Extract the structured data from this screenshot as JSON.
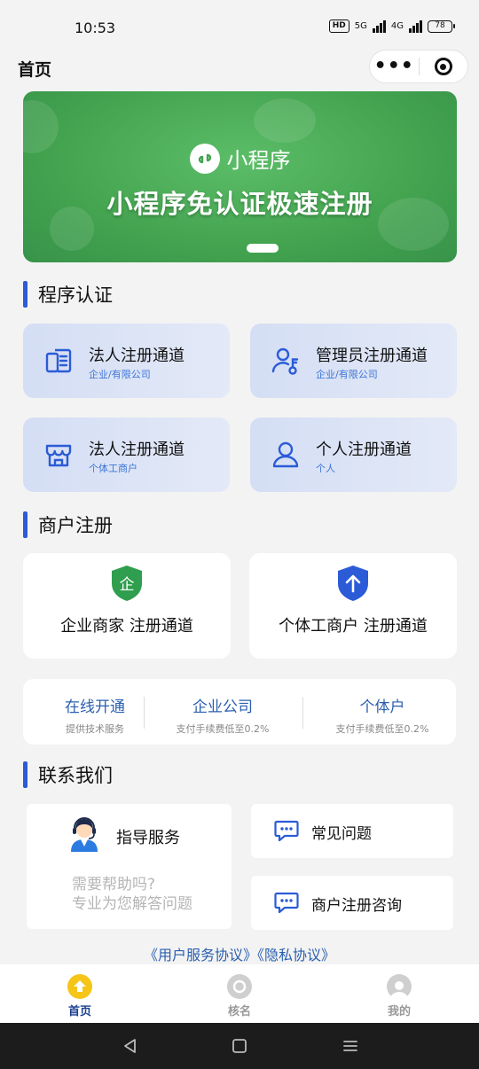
{
  "status_bar": {
    "time": "10:53",
    "hd": "HD",
    "net1": "5G",
    "net2": "4G",
    "battery": "78"
  },
  "nav": {
    "title": "首页",
    "more": "•••"
  },
  "banner": {
    "brand": "小程序",
    "headline": "小程序免认证极速注册"
  },
  "sections": {
    "auth": "程序认证",
    "merchant": "商户注册",
    "contact": "联系我们"
  },
  "auth_cards": [
    {
      "title": "法人注册通道",
      "sub": "企业/有限公司",
      "icon": "building-doc-icon"
    },
    {
      "title": "管理员注册通道",
      "sub": "企业/有限公司",
      "icon": "admin-user-key-icon"
    },
    {
      "title": "法人注册通道",
      "sub": "个体工商户",
      "icon": "shop-icon"
    },
    {
      "title": "个人注册通道",
      "sub": "个人",
      "icon": "person-icon"
    }
  ],
  "merchant_cards": [
    {
      "label": "企业商家 注册通道",
      "badge": "企",
      "color": "#2f9e4e"
    },
    {
      "label": "个体工商户 注册通道",
      "badge": "↑",
      "color": "#2b5bd7"
    }
  ],
  "features": [
    {
      "title": "在线开通",
      "sub": "提供技术服务"
    },
    {
      "title": "企业公司",
      "sub": "支付手续费低至0.2%"
    },
    {
      "title": "个体户",
      "sub": "支付手续费低至0.2%"
    }
  ],
  "contact": {
    "guide_title": "指导服务",
    "guide_line1": "需要帮助吗?",
    "guide_line2": "专业为您解答问题",
    "faq": "常见问题",
    "consult": "商户注册咨询"
  },
  "agreement": "《用户服务协议》《隐私协议》",
  "tabs": [
    {
      "label": "首页",
      "active": true
    },
    {
      "label": "核名",
      "active": false
    },
    {
      "label": "我的",
      "active": false
    }
  ],
  "colors": {
    "accent": "#2b5bd7",
    "link": "#2a5fae",
    "banner_green": "#43a34f",
    "tab_active": "#1a3f8f",
    "tab_inactive": "#999999"
  }
}
